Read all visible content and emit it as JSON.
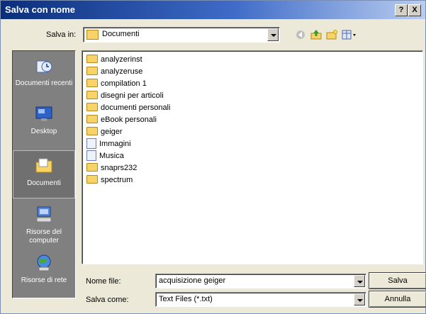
{
  "window": {
    "title": "Salva con nome",
    "help_label": "?",
    "close_label": "X"
  },
  "lookin": {
    "label": "Salva in:",
    "value": "Documenti"
  },
  "places": [
    {
      "label": "Documenti recenti",
      "icon": "recent-documents-icon"
    },
    {
      "label": "Desktop",
      "icon": "desktop-icon"
    },
    {
      "label": "Documenti",
      "icon": "my-documents-icon"
    },
    {
      "label": "Risorse del computer",
      "icon": "my-computer-icon"
    },
    {
      "label": "Risorse di rete",
      "icon": "network-places-icon"
    }
  ],
  "files": [
    {
      "name": "analyzerinst",
      "icon": "folder-icon"
    },
    {
      "name": "analyzeruse",
      "icon": "folder-icon"
    },
    {
      "name": "compilation 1",
      "icon": "folder-icon"
    },
    {
      "name": "disegni per articoli",
      "icon": "folder-icon"
    },
    {
      "name": "documenti personali",
      "icon": "folder-icon"
    },
    {
      "name": "eBook personali",
      "icon": "folder-icon"
    },
    {
      "name": "geiger",
      "icon": "folder-icon"
    },
    {
      "name": "Immagini",
      "icon": "special-folder-icon"
    },
    {
      "name": "Musica",
      "icon": "special-folder-icon"
    },
    {
      "name": "snaprs232",
      "icon": "folder-icon"
    },
    {
      "name": "spectrum",
      "icon": "folder-icon"
    }
  ],
  "filename": {
    "label": "Nome file:",
    "value": "acquisizione geiger"
  },
  "filetype": {
    "label": "Salva come:",
    "value": "Text Files (*.txt)"
  },
  "buttons": {
    "save": "Salva",
    "cancel": "Annulla"
  }
}
